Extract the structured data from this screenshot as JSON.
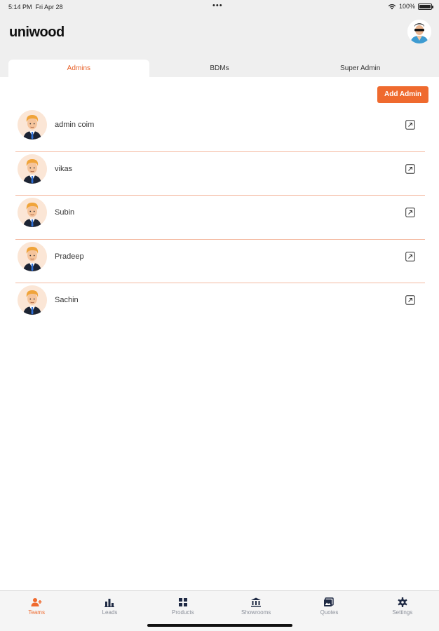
{
  "status": {
    "time": "5:14 PM",
    "date": "Fri Apr 28",
    "battery": "100%"
  },
  "app": {
    "logo": "uniwood"
  },
  "tabs": [
    {
      "label": "Admins",
      "active": true
    },
    {
      "label": "BDMs",
      "active": false
    },
    {
      "label": "Super Admin",
      "active": false
    }
  ],
  "toolbar": {
    "add_label": "Add Admin"
  },
  "admins": [
    {
      "name": "admin coim"
    },
    {
      "name": "vikas"
    },
    {
      "name": "Subin"
    },
    {
      "name": "Pradeep"
    },
    {
      "name": "Sachin"
    }
  ],
  "nav": [
    {
      "label": "Teams",
      "icon": "teams-icon",
      "active": true
    },
    {
      "label": "Leads",
      "icon": "leads-icon",
      "active": false
    },
    {
      "label": "Products",
      "icon": "products-icon",
      "active": false
    },
    {
      "label": "Showrooms",
      "icon": "showrooms-icon",
      "active": false
    },
    {
      "label": "Quotes",
      "icon": "quotes-icon",
      "active": false
    },
    {
      "label": "Settings",
      "icon": "settings-icon",
      "active": false
    }
  ],
  "colors": {
    "accent": "#ef6a2e",
    "divider": "#f4b9a0",
    "nav_inactive": "#1f2a44"
  }
}
